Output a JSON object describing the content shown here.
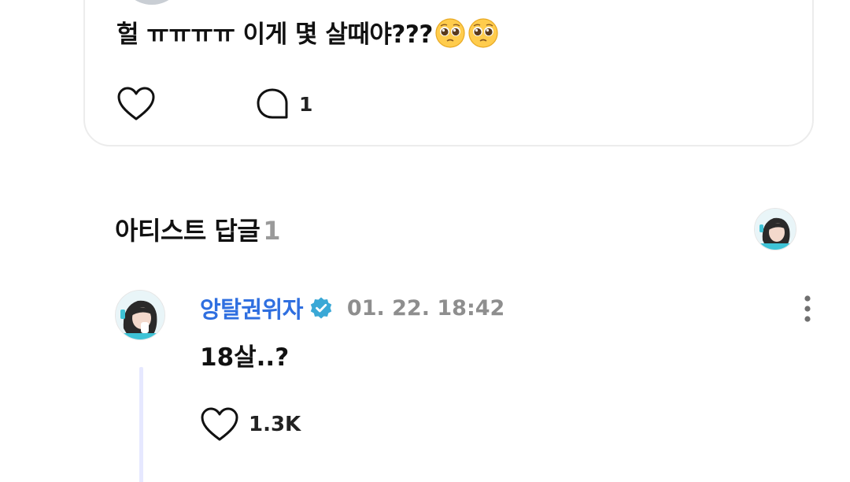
{
  "fan_comment": {
    "text": "헐 ㅠㅠㅠㅠ 이게 몇 살때야???",
    "emoji": [
      "pleading-face",
      "pleading-face"
    ],
    "reply_count": "1"
  },
  "artist_section": {
    "title": "아티스트 답글",
    "count": "1"
  },
  "artist_reply": {
    "author": "앙탈권위자",
    "timestamp": "01. 22. 18:42",
    "text": "18살..?",
    "like_count": "1.3K",
    "accent_color": "#2f6fe0"
  }
}
